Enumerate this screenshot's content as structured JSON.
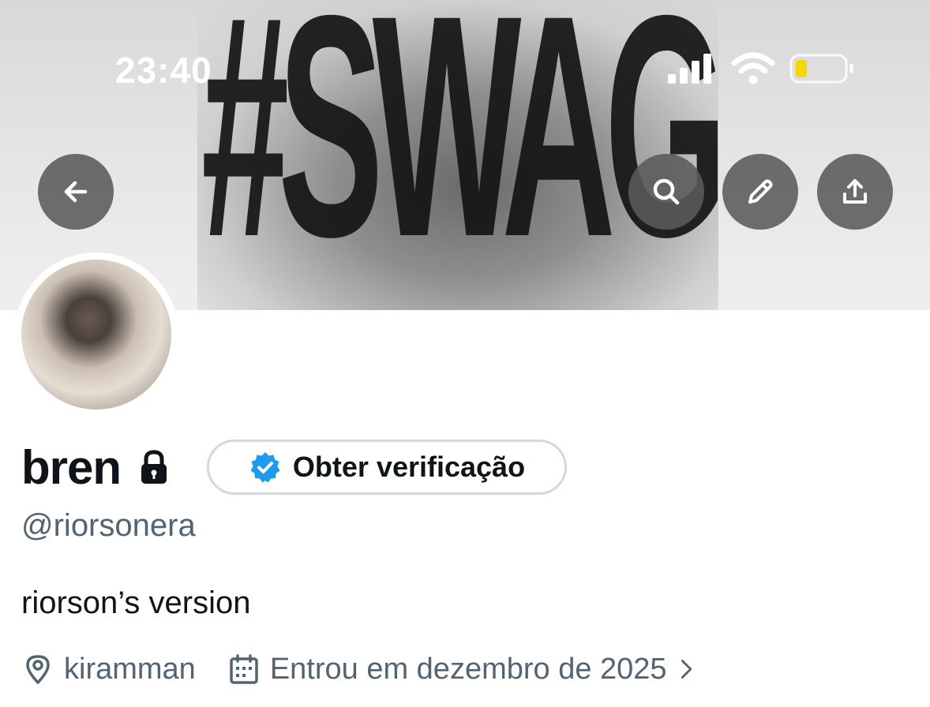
{
  "status_bar": {
    "time": "23:40",
    "icons": [
      "signal-icon",
      "wifi-icon",
      "battery-icon"
    ],
    "battery_color": "#f5d800"
  },
  "banner": {
    "text": "#SWAG"
  },
  "header_actions": {
    "back": "arrow-left-icon",
    "search": "search-icon",
    "edit": "pencil-icon",
    "share": "share-icon"
  },
  "profile": {
    "display_name": "bren",
    "locked_icon": "lock-icon",
    "handle": "@riorsonera",
    "bio": "riorson’s version",
    "location": "kiramman",
    "joined": "Entrou em dezembro de 2025"
  },
  "verification": {
    "label": "Obter verificação",
    "icon": "verified-badge-icon",
    "badge_color": "#1d9bf0"
  },
  "colors": {
    "text_primary": "#0f1419",
    "text_secondary": "#536471",
    "border": "#cfd9de"
  }
}
